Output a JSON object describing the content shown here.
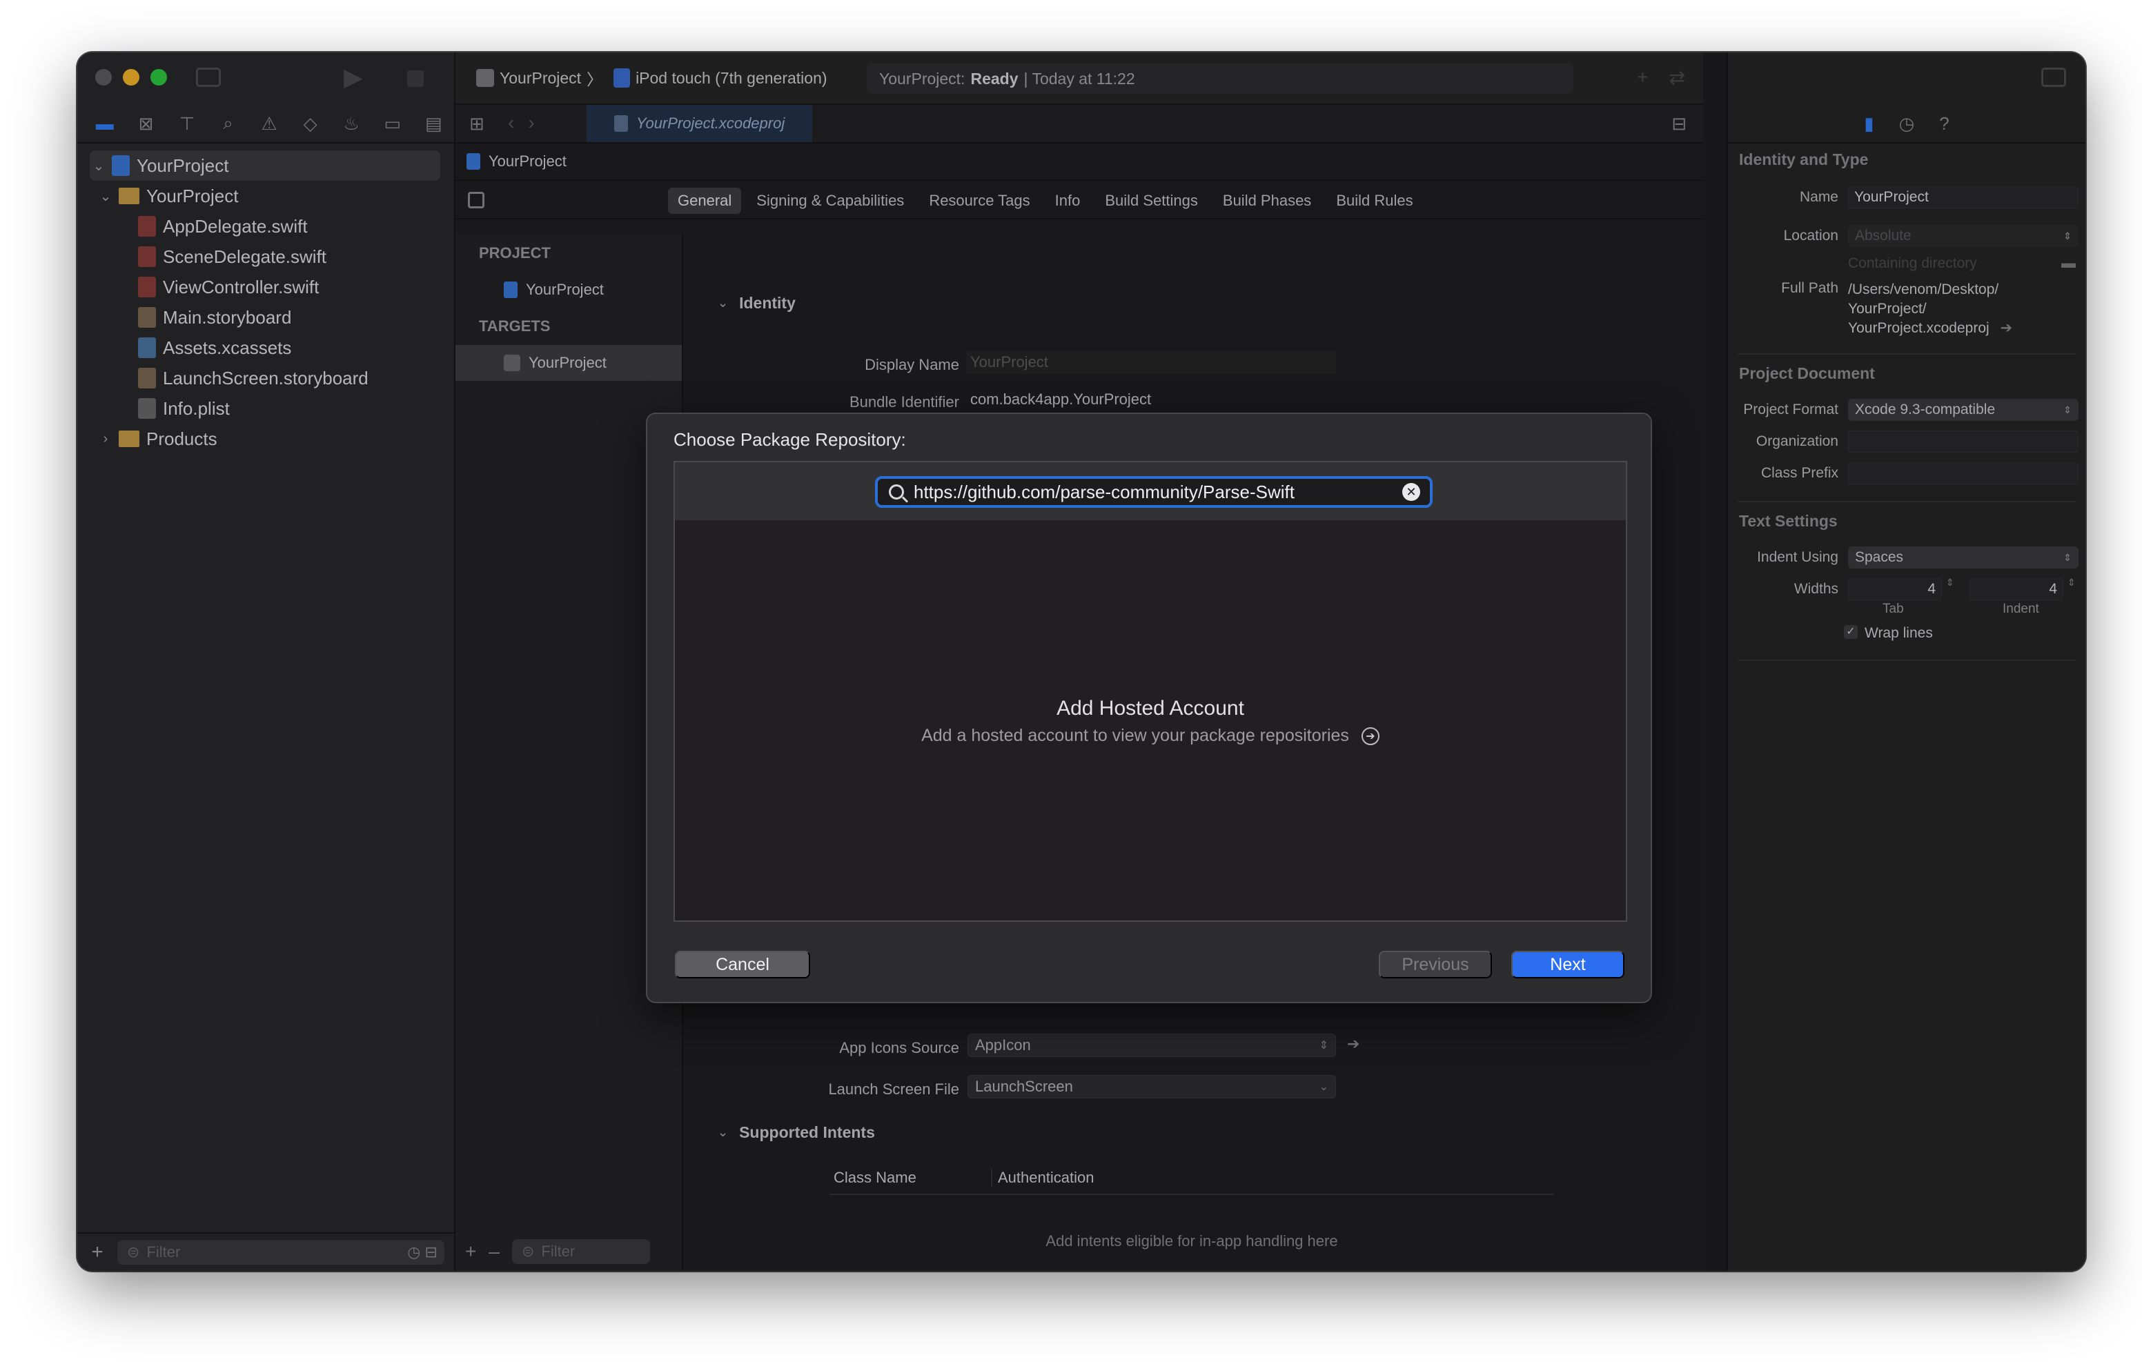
{
  "navigator": {
    "root": "YourProject",
    "group": "YourProject",
    "files": [
      "AppDelegate.swift",
      "SceneDelegate.swift",
      "ViewController.swift",
      "Main.storyboard",
      "Assets.xcassets",
      "LaunchScreen.storyboard",
      "Info.plist"
    ],
    "products": "Products",
    "filter_placeholder": "Filter"
  },
  "toolbar": {
    "scheme": "YourProject",
    "device": "iPod touch (7th generation)",
    "status_project": "YourProject:",
    "status_state": "Ready",
    "status_time": "| Today at 11:22"
  },
  "editor": {
    "file_tab": "YourProject.xcodeproj",
    "jump_bar": "YourProject",
    "tabs": [
      "General",
      "Signing & Capabilities",
      "Resource Tags",
      "Info",
      "Build Settings",
      "Build Phases",
      "Build Rules"
    ],
    "project_header": "PROJECT",
    "project_item": "YourProject",
    "targets_header": "TARGETS",
    "target_item": "YourProject",
    "filter_placeholder": "Filter",
    "identity_header": "Identity",
    "display_name_label": "Display Name",
    "display_name_value": "YourProject",
    "bundle_id_label": "Bundle Identifier",
    "bundle_id_value": "com.back4app.YourProject",
    "app_icons_label": "App Icons Source",
    "app_icons_value": "AppIcon",
    "launch_screen_label": "Launch Screen File",
    "launch_screen_value": "LaunchScreen",
    "intents_header": "Supported Intents",
    "intents_col1": "Class Name",
    "intents_col2": "Authentication",
    "intents_empty": "Add intents eligible for in-app handling here"
  },
  "inspector": {
    "identity_header": "Identity and Type",
    "name_label": "Name",
    "name_value": "YourProject",
    "location_label": "Location",
    "location_value": "Absolute",
    "location_sub": "Containing directory",
    "full_path_label": "Full Path",
    "full_path_1": "/Users/venom/Desktop/",
    "full_path_2": "YourProject/",
    "full_path_3": "YourProject.xcodeproj",
    "doc_header": "Project Document",
    "format_label": "Project Format",
    "format_value": "Xcode 9.3-compatible",
    "org_label": "Organization",
    "prefix_label": "Class Prefix",
    "text_header": "Text Settings",
    "indent_label": "Indent Using",
    "indent_value": "Spaces",
    "widths_label": "Widths",
    "tab_value": "4",
    "indent_width_value": "4",
    "tab_caption": "Tab",
    "indent_caption": "Indent",
    "wrap_label": "Wrap lines"
  },
  "modal": {
    "title": "Choose Package Repository:",
    "search_value": "https://github.com/parse-community/Parse-Swift",
    "hosted_title": "Add Hosted Account",
    "hosted_subtitle": "Add a hosted account to view your package repositories",
    "cancel": "Cancel",
    "previous": "Previous",
    "next": "Next"
  }
}
